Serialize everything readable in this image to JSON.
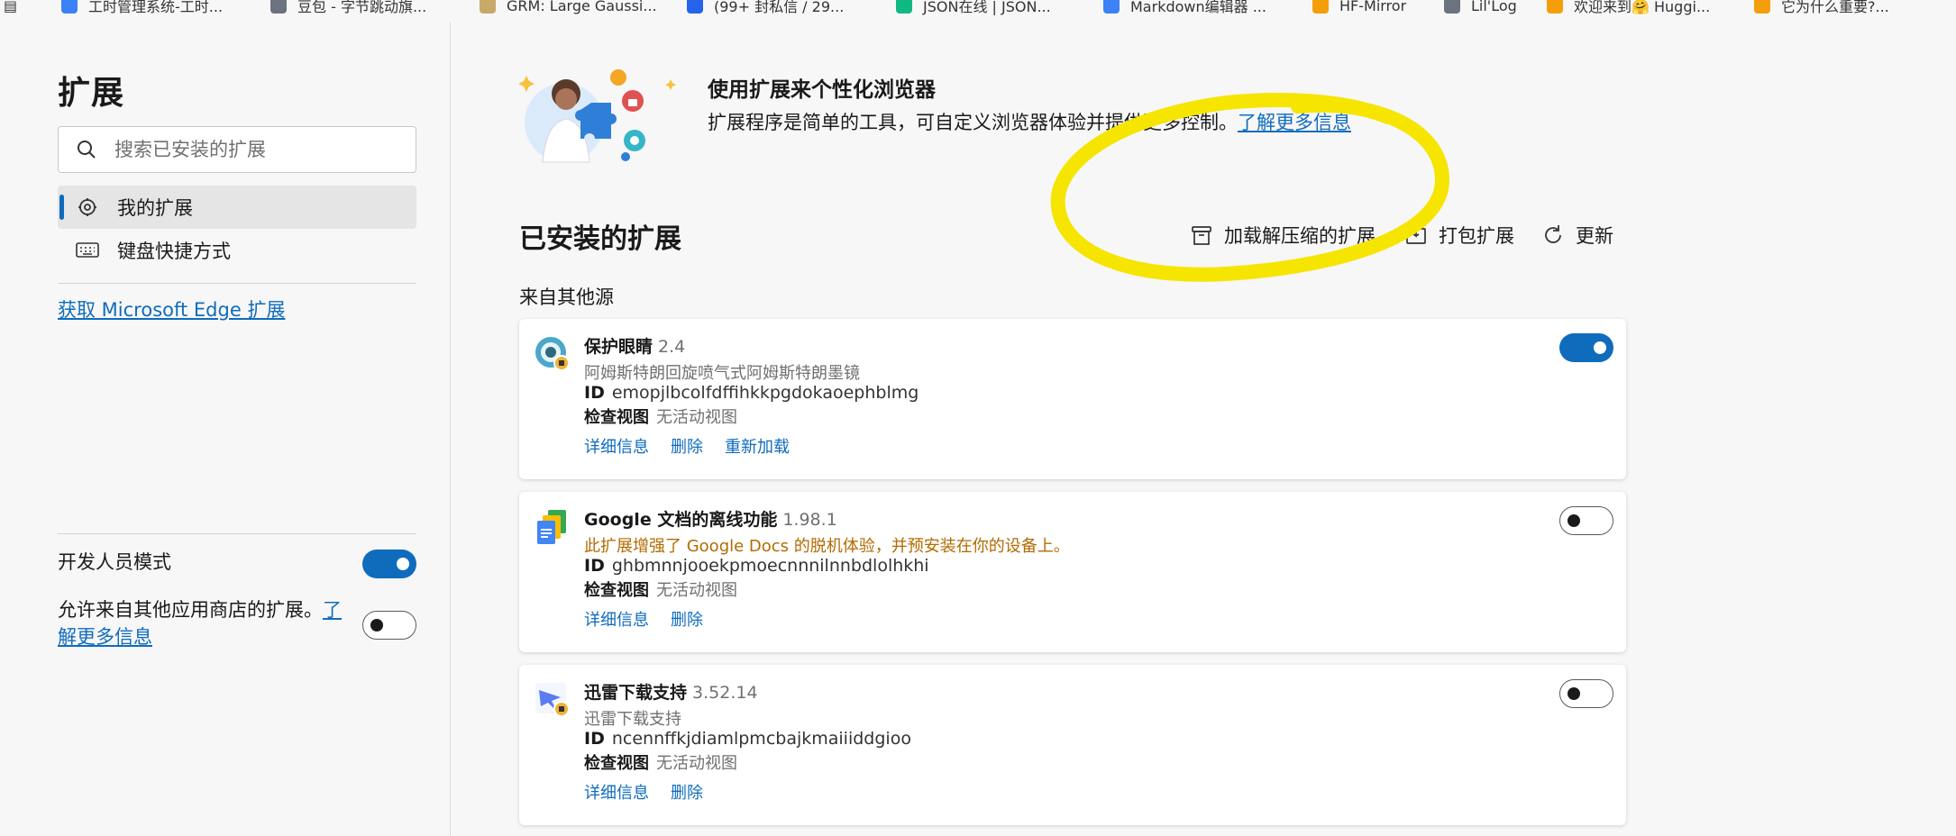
{
  "bookmarks": [
    {
      "label": "工时管理系统-工时...",
      "color": "#3b82f6"
    },
    {
      "label": "豆包 - 字节跳动旗...",
      "color": "#6b7280"
    },
    {
      "label": "GRM: Large Gaussi...",
      "color": "#c8a96a"
    },
    {
      "label": "(99+ 封私信 / 29...",
      "color": "#2563eb"
    },
    {
      "label": "JSON在线 | JSON...",
      "color": "#10b981"
    },
    {
      "label": "Markdown编辑器 ...",
      "color": "#3b82f6"
    },
    {
      "label": "HF-Mirror",
      "color": "#f59e0b"
    },
    {
      "label": "Lil'Log",
      "color": "#6b7280"
    },
    {
      "label": "欢迎来到🤗 Huggi...",
      "color": "#f59e0b"
    },
    {
      "label": "它为什么重要?...",
      "color": "#f59e0b"
    }
  ],
  "sidebar": {
    "title": "扩展",
    "search_placeholder": "搜索已安装的扩展",
    "nav": [
      {
        "label": "我的扩展",
        "icon": "puzzle-gear-icon"
      },
      {
        "label": "键盘快捷方式",
        "icon": "keyboard-icon"
      }
    ],
    "store_link": "获取 Microsoft Edge 扩展",
    "dev_mode_label": "开发人员模式",
    "dev_mode_on": true,
    "allow_other_label": "允许来自其他应用商店的扩展。",
    "allow_other_link": "了解更多信息",
    "allow_other_on": false
  },
  "hero": {
    "title": "使用扩展来个性化浏览器",
    "desc": "扩展程序是简单的工具，可自定义浏览器体验并提供更多控制。",
    "link": "了解更多信息"
  },
  "installed": {
    "title": "已安装的扩展",
    "actions": [
      {
        "label": "加载解压缩的扩展",
        "icon": "archive-icon"
      },
      {
        "label": "打包扩展",
        "icon": "package-icon"
      },
      {
        "label": "更新",
        "icon": "refresh-icon"
      }
    ],
    "source_label": "来自其他源"
  },
  "extensions": [
    {
      "name": "保护眼睛",
      "version": "2.4",
      "desc": "阿姆斯特朗回旋喷气式阿姆斯特朗墨镜",
      "id_label": "ID",
      "id": "emopjlbcolfdffihkkpgdokaoephblmg",
      "inspect_label": "检查视图",
      "inspect_value": "无活动视图",
      "links": [
        "详细信息",
        "删除",
        "重新加载"
      ],
      "enabled": true,
      "icon": "eye-icon"
    },
    {
      "name": "Google 文档的离线功能",
      "version": "1.98.1",
      "desc": "此扩展增强了 Google Docs 的脱机体验，并预安装在你的设备上。",
      "id_label": "ID",
      "id": "ghbmnnjooekpmoecnnnilnnbdlolhkhi",
      "inspect_label": "检查视图",
      "inspect_value": "无活动视图",
      "links": [
        "详细信息",
        "删除"
      ],
      "enabled": false,
      "icon": "google-docs-icon"
    },
    {
      "name": "迅雷下载支持",
      "version": "3.52.14",
      "desc": "迅雷下载支持",
      "id_label": "ID",
      "id": "ncennffkjdiamlpmcbajkmaiiiddgioo",
      "inspect_label": "检查视图",
      "inspect_value": "无活动视图",
      "links": [
        "详细信息",
        "删除"
      ],
      "enabled": false,
      "icon": "thunder-bird-icon"
    }
  ],
  "colors": {
    "accent": "#0f6cbd",
    "annotation": "#f5e500",
    "warning_text": "#b36b00"
  }
}
